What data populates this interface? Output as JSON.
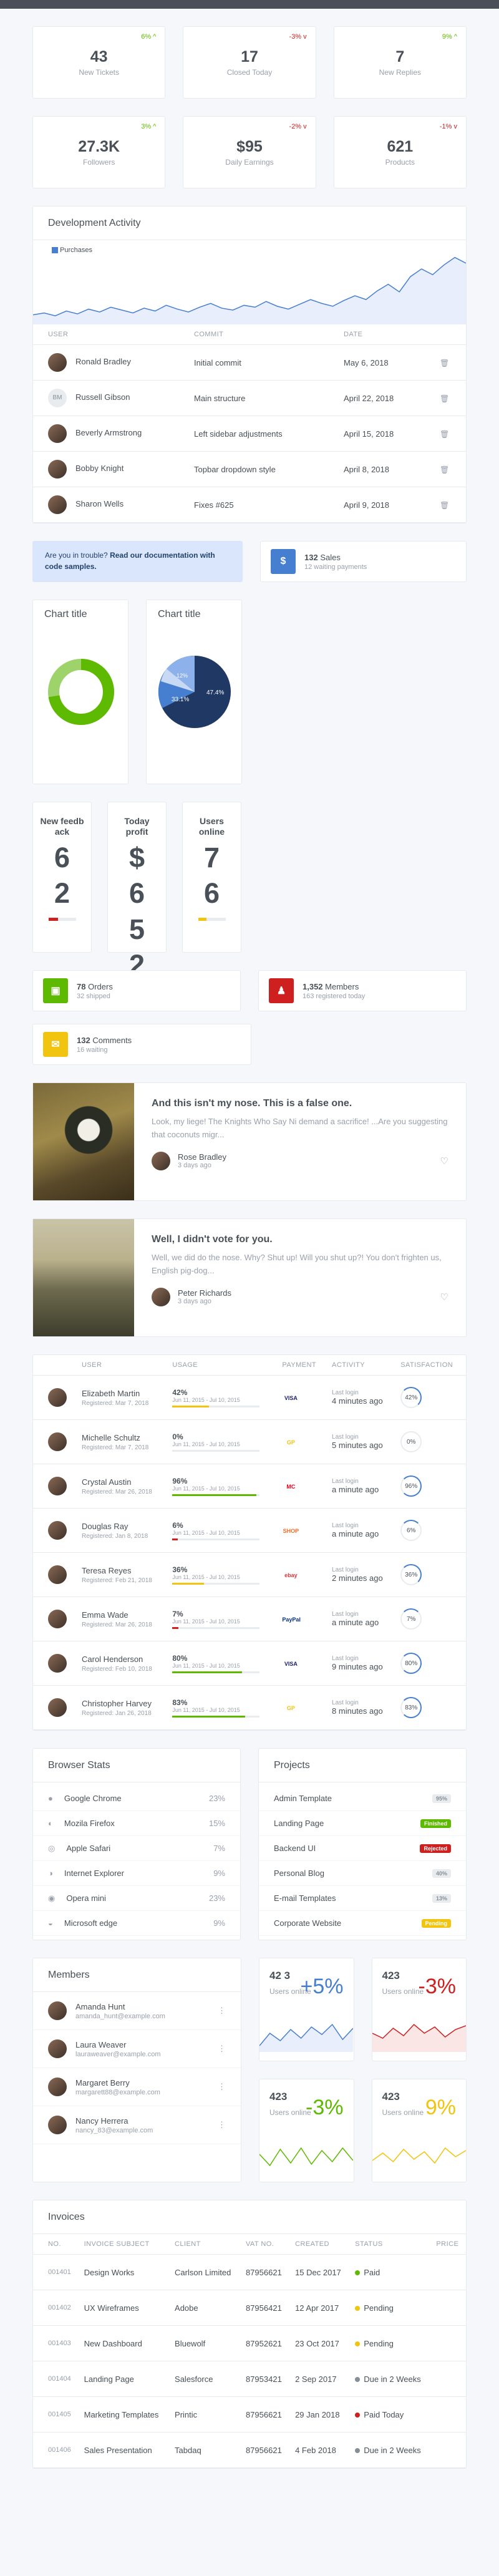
{
  "stats_row1": [
    {
      "value": "43",
      "label": "New Tickets",
      "change": "6% ^",
      "dir": "up"
    },
    {
      "value": "17",
      "label": "Closed Today",
      "change": "-3% v",
      "dir": "down"
    },
    {
      "value": "7",
      "label": "New Replies",
      "change": "9% ^",
      "dir": "up"
    }
  ],
  "stats_row2": [
    {
      "value": "27.3K",
      "label": "Followers",
      "change": "3% ^",
      "dir": "up"
    },
    {
      "value": "$95",
      "label": "Daily Earnings",
      "change": "-2% v",
      "dir": "down"
    },
    {
      "value": "621",
      "label": "Products",
      "change": "-1% v",
      "dir": "down"
    }
  ],
  "activity": {
    "title": "Development Activity",
    "legend": "Purchases",
    "chart_data": {
      "type": "area",
      "series": [
        {
          "name": "Purchases",
          "values": [
            10,
            12,
            9,
            14,
            11,
            16,
            13,
            18,
            15,
            12,
            17,
            14,
            20,
            16,
            13,
            18,
            22,
            17,
            15,
            20,
            18,
            24,
            19,
            16,
            21,
            26,
            22,
            19,
            25,
            30,
            26,
            35,
            42,
            34,
            50,
            58,
            52,
            62,
            70,
            64
          ]
        }
      ],
      "ylim": [
        0,
        75
      ]
    },
    "columns": [
      "User",
      "Commit",
      "Date",
      ""
    ],
    "rows": [
      {
        "user": "Ronald Bradley",
        "commit": "Initial commit",
        "date": "May 6, 2018",
        "initials": ""
      },
      {
        "user": "Russell Gibson",
        "commit": "Main structure",
        "date": "April 22, 2018",
        "initials": "BM"
      },
      {
        "user": "Beverly Armstrong",
        "commit": "Left sidebar adjustments",
        "date": "April 15, 2018",
        "initials": ""
      },
      {
        "user": "Bobby Knight",
        "commit": "Topbar dropdown style",
        "date": "April 8, 2018",
        "initials": ""
      },
      {
        "user": "Sharon Wells",
        "commit": "Fixes #625",
        "date": "April 9, 2018",
        "initials": ""
      }
    ]
  },
  "alert": {
    "text": "Are you in trouble? ",
    "strong": "Read our documentation with code samples."
  },
  "sales": {
    "icon": "$",
    "count": "132",
    "label": "Sales",
    "sub": "12 waiting payments"
  },
  "chart_title_1": "Chart title",
  "chart_title_2": "Chart title",
  "pie_labels": [
    "47.4%",
    "33.1%",
    "12%"
  ],
  "tall": [
    {
      "head": "New feedb ack",
      "digits": [
        "6",
        "2"
      ],
      "bar": 0.35,
      "color": "#cd201f"
    },
    {
      "head": "Today profit",
      "digits": [
        "$",
        "6",
        "5",
        "2"
      ],
      "bar": 1.0,
      "color": "#5eba00"
    },
    {
      "head": "Users online",
      "digits": [
        "7",
        "6"
      ],
      "bar": 0.3,
      "color": "#f1c40f"
    }
  ],
  "orders": {
    "count": "78",
    "label": "Orders",
    "sub": "32 shipped"
  },
  "members_small": {
    "count": "1,352",
    "label": "Members",
    "sub": "163 registered today"
  },
  "comments": {
    "count": "132",
    "label": "Comments",
    "sub": "16 waiting"
  },
  "posts": [
    {
      "title": "And this isn't my nose. This is a false one.",
      "text": "Look, my liege! The Knights Who Say Ni demand a sacrifice! ...Are you suggesting that coconuts migr...",
      "author": "Rose Bradley",
      "time": "3 days ago"
    },
    {
      "title": "Well, I didn't vote for you.",
      "text": "Well, we did do the nose. Why? Shut up! Will you shut up?! You don't frighten us, English pig-dog...",
      "author": "Peter Richards",
      "time": "3 days ago"
    }
  ],
  "users_table": {
    "columns": [
      "User",
      "Usage",
      "Payment",
      "Activity",
      "Satisfaction"
    ],
    "rows": [
      {
        "name": "Elizabeth Martin",
        "reg": "Registered: Mar 7, 2018",
        "pct": "42%",
        "range": "Jun 11, 2015 - Jul 10, 2015",
        "usage": 0.42,
        "bar": "#f1c40f",
        "pay": "VISA",
        "act1": "Last login",
        "act2": "4 minutes ago",
        "sat": "42%"
      },
      {
        "name": "Michelle Schultz",
        "reg": "Registered: Mar 7, 2018",
        "pct": "0%",
        "range": "Jun 11, 2015 - Jul 10, 2015",
        "usage": 0.0,
        "bar": "#cd201f",
        "pay": "GP",
        "act1": "Last login",
        "act2": "5 minutes ago",
        "sat": "0%"
      },
      {
        "name": "Crystal Austin",
        "reg": "Registered: Mar 26, 2018",
        "pct": "96%",
        "range": "Jun 11, 2015 - Jul 10, 2015",
        "usage": 0.96,
        "bar": "#5eba00",
        "pay": "MC",
        "act1": "Last login",
        "act2": "a minute ago",
        "sat": "96%"
      },
      {
        "name": "Douglas Ray",
        "reg": "Registered: Jan 8, 2018",
        "pct": "6%",
        "range": "Jun 11, 2015 - Jul 10, 2015",
        "usage": 0.06,
        "bar": "#cd201f",
        "pay": "SHOP",
        "act1": "Last login",
        "act2": "a minute ago",
        "sat": "6%"
      },
      {
        "name": "Teresa Reyes",
        "reg": "Registered: Feb 21, 2018",
        "pct": "36%",
        "range": "Jun 11, 2015 - Jul 10, 2015",
        "usage": 0.36,
        "bar": "#f1c40f",
        "pay": "ebay",
        "act1": "Last login",
        "act2": "2 minutes ago",
        "sat": "36%"
      },
      {
        "name": "Emma Wade",
        "reg": "Registered: Mar 26, 2018",
        "pct": "7%",
        "range": "Jun 11, 2015 - Jul 10, 2015",
        "usage": 0.07,
        "bar": "#cd201f",
        "pay": "PayPal",
        "act1": "Last login",
        "act2": "a minute ago",
        "sat": "7%"
      },
      {
        "name": "Carol Henderson",
        "reg": "Registered: Feb 10, 2018",
        "pct": "80%",
        "range": "Jun 11, 2015 - Jul 10, 2015",
        "usage": 0.8,
        "bar": "#5eba00",
        "pay": "VISA",
        "act1": "Last login",
        "act2": "9 minutes ago",
        "sat": "80%"
      },
      {
        "name": "Christopher Harvey",
        "reg": "Registered: Jan 26, 2018",
        "pct": "83%",
        "range": "Jun 11, 2015 - Jul 10, 2015",
        "usage": 0.83,
        "bar": "#5eba00",
        "pay": "GP",
        "act1": "Last login",
        "act2": "8 minutes ago",
        "sat": "83%"
      }
    ]
  },
  "browser": {
    "title": "Browser Stats",
    "items": [
      {
        "name": "Google Chrome",
        "pct": "23%"
      },
      {
        "name": "Mozila Firefox",
        "pct": "15%"
      },
      {
        "name": "Apple Safari",
        "pct": "7%"
      },
      {
        "name": "Internet Explorer",
        "pct": "9%"
      },
      {
        "name": "Opera mini",
        "pct": "23%"
      },
      {
        "name": "Microsoft edge",
        "pct": "9%"
      }
    ]
  },
  "projects": {
    "title": "Projects",
    "items": [
      {
        "name": "Admin Template",
        "badge": "95%",
        "color": ""
      },
      {
        "name": "Landing Page",
        "badge": "Finished",
        "color": "#5eba00"
      },
      {
        "name": "Backend UI",
        "badge": "Rejected",
        "color": "#cd201f"
      },
      {
        "name": "Personal Blog",
        "badge": "40%",
        "color": ""
      },
      {
        "name": "E-mail Templates",
        "badge": "13%",
        "color": ""
      },
      {
        "name": "Corporate Website",
        "badge": "Pending",
        "color": "#f1c40f"
      }
    ]
  },
  "members": {
    "title": "Members",
    "items": [
      {
        "name": "Amanda Hunt",
        "email": "amanda_hunt@example.com"
      },
      {
        "name": "Laura Weaver",
        "email": "lauraweaver@example.com"
      },
      {
        "name": "Margaret Berry",
        "email": "margarett88@example.com"
      },
      {
        "name": "Nancy Herrera",
        "email": "nancy_83@example.com"
      }
    ]
  },
  "sparks": [
    {
      "num": "42 3",
      "pct": "+5%",
      "label": "Users online",
      "color": "#467fcf",
      "fill": "#e8eefb",
      "values": [
        10,
        30,
        18,
        36,
        22,
        40,
        28,
        44,
        20,
        38
      ]
    },
    {
      "num": "423",
      "pct": "-3%",
      "label": "Users online",
      "color": "#cd201f",
      "fill": "#fbe6e6",
      "values": [
        30,
        22,
        38,
        26,
        44,
        30,
        40,
        24,
        36,
        42
      ]
    },
    {
      "num": "423",
      "pct": "-3%",
      "label": "Users online",
      "color": "#5eba00",
      "fill": "",
      "values": [
        30,
        12,
        38,
        16,
        40,
        14,
        36,
        18,
        40,
        20
      ]
    },
    {
      "num": "423",
      "pct": "9%",
      "label": "Users online",
      "color": "#f1c40f",
      "fill": "",
      "values": [
        20,
        32,
        18,
        38,
        22,
        34,
        16,
        40,
        26,
        36
      ]
    }
  ],
  "invoices": {
    "title": "Invoices",
    "columns": [
      "No.",
      "Invoice Subject",
      "Client",
      "VAT No.",
      "Created",
      "Status",
      "Price"
    ],
    "rows": [
      {
        "no": "001401",
        "subject": "Design Works",
        "client": "Carlson Limited",
        "vat": "87956621",
        "created": "15 Dec 2017",
        "status": "Paid",
        "color": "#5eba00"
      },
      {
        "no": "001402",
        "subject": "UX Wireframes",
        "client": "Adobe",
        "vat": "87956421",
        "created": "12 Apr 2017",
        "status": "Pending",
        "color": "#f1c40f"
      },
      {
        "no": "001403",
        "subject": "New Dashboard",
        "client": "Bluewolf",
        "vat": "87952621",
        "created": "23 Oct 2017",
        "status": "Pending",
        "color": "#f1c40f"
      },
      {
        "no": "001404",
        "subject": "Landing Page",
        "client": "Salesforce",
        "vat": "87953421",
        "created": "2 Sep 2017",
        "status": "Due in 2 Weeks",
        "color": "#868e96"
      },
      {
        "no": "001405",
        "subject": "Marketing Templates",
        "client": "Printic",
        "vat": "87956621",
        "created": "29 Jan 2018",
        "status": "Paid Today",
        "color": "#cd201f"
      },
      {
        "no": "001406",
        "subject": "Sales Presentation",
        "client": "Tabdaq",
        "vat": "87956621",
        "created": "4 Feb 2018",
        "status": "Due in 2 Weeks",
        "color": "#868e96"
      }
    ]
  }
}
